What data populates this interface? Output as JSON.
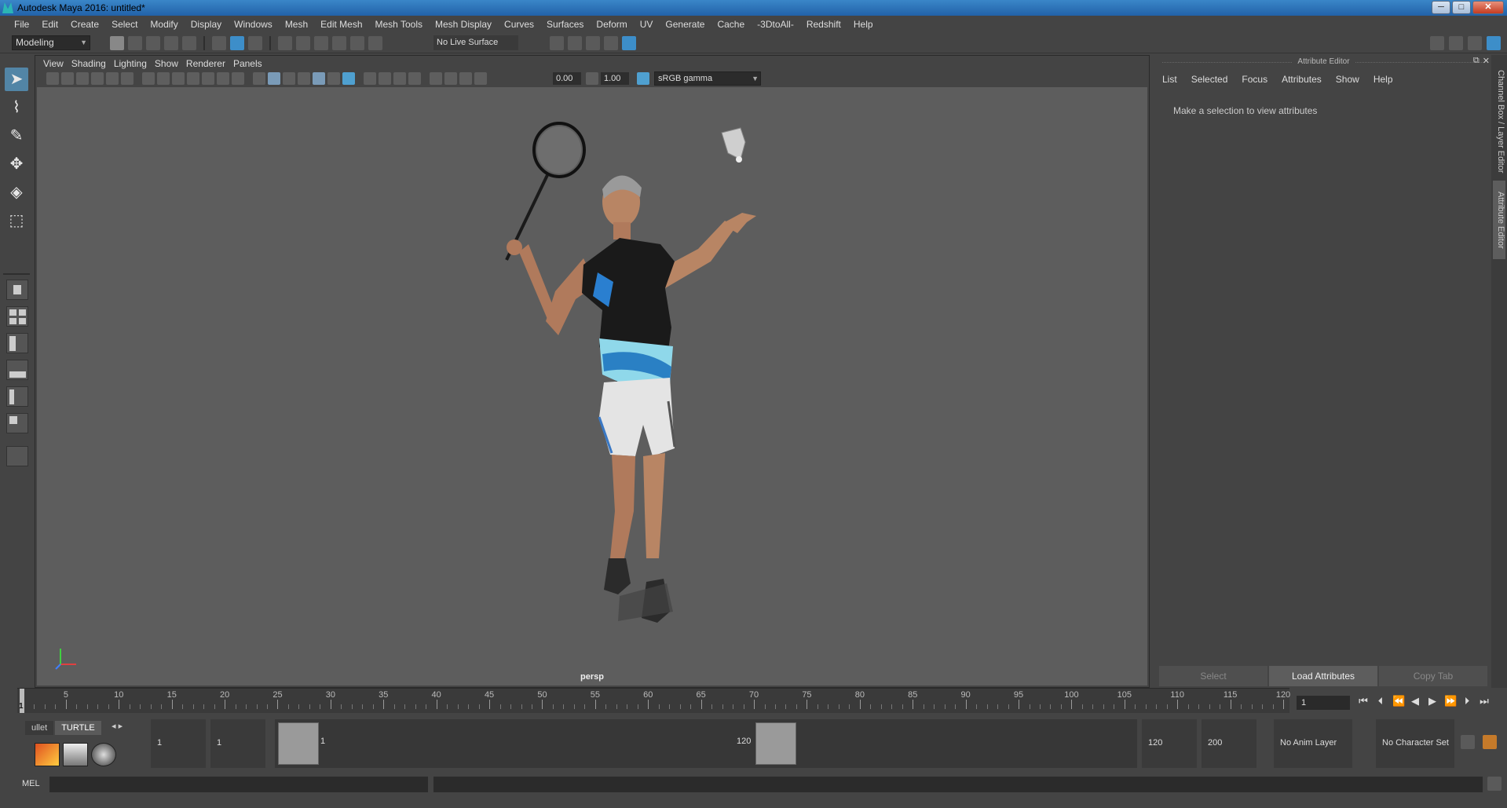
{
  "window": {
    "title": "Autodesk Maya 2016: untitled*",
    "buttons": {
      "minimize": "─",
      "maximize": "□",
      "close": "✕"
    }
  },
  "menubar": {
    "items": [
      "File",
      "Edit",
      "Create",
      "Select",
      "Modify",
      "Display",
      "Windows",
      "Mesh",
      "Edit Mesh",
      "Mesh Tools",
      "Mesh Display",
      "Curves",
      "Surfaces",
      "Deform",
      "UV",
      "Generate",
      "Cache",
      "-3DtoAll-",
      "Redshift",
      "Help"
    ]
  },
  "statusline": {
    "mode": "Modeling",
    "live_surface": "No Live Surface"
  },
  "viewport": {
    "menus": [
      "View",
      "Shading",
      "Lighting",
      "Show",
      "Renderer",
      "Panels"
    ],
    "exposure": "0.00",
    "gamma": "1.00",
    "color_space": "sRGB gamma",
    "camera_label": "persp"
  },
  "attribute_editor": {
    "title": "Attribute Editor",
    "menus": [
      "List",
      "Selected",
      "Focus",
      "Attributes",
      "Show",
      "Help"
    ],
    "message": "Make a selection to view attributes",
    "buttons": {
      "select": "Select",
      "load": "Load Attributes",
      "copy": "Copy Tab"
    }
  },
  "side_tabs": {
    "channel_box": "Channel Box / Layer Editor",
    "attribute_editor": "Attribute Editor"
  },
  "timeline": {
    "tick_labels": [
      "5",
      "10",
      "15",
      "20",
      "25",
      "30",
      "35",
      "40",
      "45",
      "50",
      "55",
      "60",
      "65",
      "70",
      "75",
      "80",
      "85",
      "90",
      "95",
      "100",
      "105",
      "110",
      "115",
      "120"
    ],
    "current_marker": "1",
    "current_frame": "1"
  },
  "range": {
    "shelf_tabs": [
      "ullet",
      "TURTLE"
    ],
    "start_frame": "1",
    "playback_start": "1",
    "range_start_label": "1",
    "range_end_label": "120",
    "playback_end": "120",
    "end_frame": "200",
    "anim_layer": "No Anim Layer",
    "character_set": "No Character Set"
  },
  "command_line": {
    "language": "MEL"
  },
  "colors": {
    "title_bar": "#2262a8",
    "ui_bg": "#444444",
    "viewport_bg": "#5d5d5d",
    "accent": "#5285a6"
  }
}
